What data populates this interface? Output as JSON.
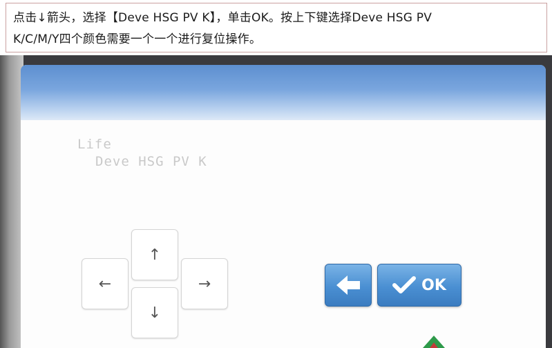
{
  "caption": {
    "line1": "点击↓箭头，选择【Deve   HSG   PV   K】，单击OK。按上下键选择Deve   HSG   PV",
    "line2": "K/C/M/Y四个颜色需要一个一个进行复位操作。"
  },
  "screen": {
    "life_label": "Life",
    "item_label": "Deve HSG PV K"
  },
  "keys": {
    "up": "↑",
    "down": "↓",
    "left": "←",
    "right": "→"
  },
  "buttons": {
    "ok_label": "OK"
  },
  "colors": {
    "button_blue": "#4a8fd2",
    "header_blue": "#5d8fd0",
    "caption_border": "#c9a0a0"
  },
  "icons": {
    "back": "back-arrow-icon",
    "check": "check-icon"
  }
}
